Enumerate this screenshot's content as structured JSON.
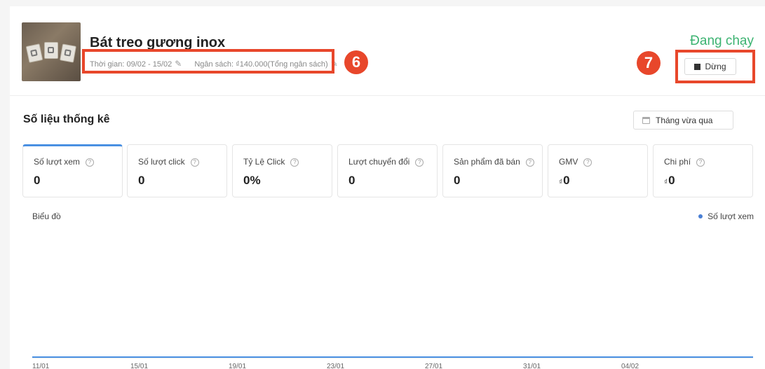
{
  "header": {
    "product_title": "Bát treo gương inox",
    "time_label": "Thời gian: 09/02 - 15/02",
    "budget_label": "Ngân sách: ₫140.000(Tổng ngân sách)",
    "status": "Đang chạy",
    "stop_label": "Dừng",
    "status_color": "#3cb371"
  },
  "annotations": {
    "box6": "6",
    "box7": "7",
    "color": "#e8472b"
  },
  "stats": {
    "title": "Số liệu thống kê",
    "date_range": "Tháng vừa qua",
    "metrics": [
      {
        "label": "Số lượt xem",
        "value": "0"
      },
      {
        "label": "Số lượt click",
        "value": "0"
      },
      {
        "label": "Tỷ Lệ Click",
        "value": "0%"
      },
      {
        "label": "Lượt chuyển đổi",
        "value": "0"
      },
      {
        "label": "Sản phẩm đã bán",
        "value": "0"
      },
      {
        "label": "GMV",
        "currency": "₫",
        "value": "0"
      },
      {
        "label": "Chi phí",
        "currency": "₫",
        "value": "0"
      }
    ],
    "help_glyph": "?"
  },
  "chart_data": {
    "type": "line",
    "title": "Biểu đồ",
    "x": [
      "11/01",
      "15/01",
      "19/01",
      "23/01",
      "27/01",
      "31/01",
      "04/02"
    ],
    "series": [
      {
        "name": "Số lượt xem",
        "values": [
          0,
          0,
          0,
          0,
          0,
          0,
          0
        ]
      }
    ],
    "line_color": "#4a90e2",
    "legend": "top-right",
    "grid": false
  }
}
